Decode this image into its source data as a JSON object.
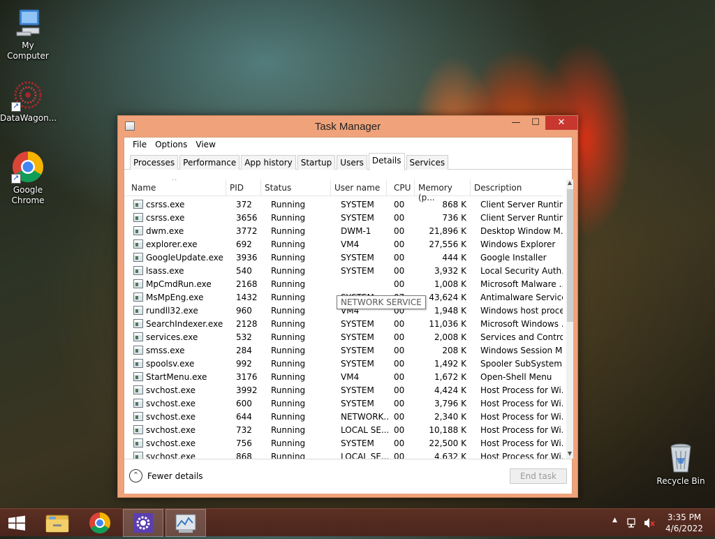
{
  "desktop": {
    "icons": [
      {
        "label": "My Computer",
        "icon": "computer-icon"
      },
      {
        "label": "DataWagon...",
        "icon": "datawagon-icon"
      },
      {
        "label": "Google Chrome",
        "icon": "chrome-icon"
      },
      {
        "label": "Recycle Bin",
        "icon": "recycle-bin-icon"
      }
    ]
  },
  "window": {
    "title": "Task Manager",
    "controls": {
      "minimize": "—",
      "maximize": "☐",
      "close": "✕"
    }
  },
  "menu": [
    "File",
    "Options",
    "View"
  ],
  "tabs": [
    {
      "label": "Processes",
      "active": false
    },
    {
      "label": "Performance",
      "active": false
    },
    {
      "label": "App history",
      "active": false
    },
    {
      "label": "Startup",
      "active": false
    },
    {
      "label": "Users",
      "active": false
    },
    {
      "label": "Details",
      "active": true
    },
    {
      "label": "Services",
      "active": false
    }
  ],
  "table": {
    "columns": [
      "Name",
      "PID",
      "Status",
      "User name",
      "CPU",
      "Memory (p...",
      "Description"
    ],
    "rows": [
      [
        "csrss.exe",
        "372",
        "Running",
        "SYSTEM",
        "00",
        "868 K",
        "Client Server Runtim..."
      ],
      [
        "csrss.exe",
        "3656",
        "Running",
        "SYSTEM",
        "00",
        "736 K",
        "Client Server Runtim..."
      ],
      [
        "dwm.exe",
        "3772",
        "Running",
        "DWM-1",
        "00",
        "21,896 K",
        "Desktop Window M..."
      ],
      [
        "explorer.exe",
        "692",
        "Running",
        "VM4",
        "00",
        "27,556 K",
        "Windows Explorer"
      ],
      [
        "GoogleUpdate.exe",
        "3936",
        "Running",
        "SYSTEM",
        "00",
        "444 K",
        "Google Installer"
      ],
      [
        "lsass.exe",
        "540",
        "Running",
        "SYSTEM",
        "00",
        "3,932 K",
        "Local Security Auth..."
      ],
      [
        "MpCmdRun.exe",
        "2168",
        "Running",
        "",
        "00",
        "1,008 K",
        "Microsoft Malware ..."
      ],
      [
        "MsMpEng.exe",
        "1432",
        "Running",
        "SYSTEM",
        "07",
        "43,624 K",
        "Antimalware Service..."
      ],
      [
        "rundll32.exe",
        "960",
        "Running",
        "VM4",
        "00",
        "1,948 K",
        "Windows host proce..."
      ],
      [
        "SearchIndexer.exe",
        "2128",
        "Running",
        "SYSTEM",
        "00",
        "11,036 K",
        "Microsoft Windows ..."
      ],
      [
        "services.exe",
        "532",
        "Running",
        "SYSTEM",
        "00",
        "2,008 K",
        "Services and Control..."
      ],
      [
        "smss.exe",
        "284",
        "Running",
        "SYSTEM",
        "00",
        "208 K",
        "Windows Session M..."
      ],
      [
        "spoolsv.exe",
        "992",
        "Running",
        "SYSTEM",
        "00",
        "1,492 K",
        "Spooler SubSystem ..."
      ],
      [
        "StartMenu.exe",
        "3176",
        "Running",
        "VM4",
        "00",
        "1,672 K",
        "Open-Shell Menu"
      ],
      [
        "svchost.exe",
        "3992",
        "Running",
        "SYSTEM",
        "00",
        "4,424 K",
        "Host Process for Wi..."
      ],
      [
        "svchost.exe",
        "600",
        "Running",
        "SYSTEM",
        "00",
        "3,796 K",
        "Host Process for Wi..."
      ],
      [
        "svchost.exe",
        "644",
        "Running",
        "NETWORK...",
        "00",
        "2,340 K",
        "Host Process for Wi..."
      ],
      [
        "svchost.exe",
        "732",
        "Running",
        "LOCAL SE...",
        "00",
        "10,188 K",
        "Host Process for Wi..."
      ],
      [
        "svchost.exe",
        "756",
        "Running",
        "SYSTEM",
        "00",
        "22,500 K",
        "Host Process for Wi..."
      ],
      [
        "svchost.exe",
        "868",
        "Running",
        "LOCAL SE...",
        "00",
        "4,632 K",
        "Host Process for Wi..."
      ]
    ],
    "tooltip": "NETWORK SERVICE"
  },
  "footer": {
    "fewer_details": "Fewer details",
    "end_task": "End task"
  },
  "taskbar": {
    "apps": [
      "start-icon",
      "file-explorer-icon",
      "chrome-icon",
      "settings-gear-icon",
      "task-manager-icon"
    ],
    "clock_time": "3:35 PM",
    "clock_date": "4/6/2022"
  },
  "colors": {
    "window_frame": "#f0a37a",
    "close_button": "#c7372f",
    "taskbar": "#4a251c"
  }
}
